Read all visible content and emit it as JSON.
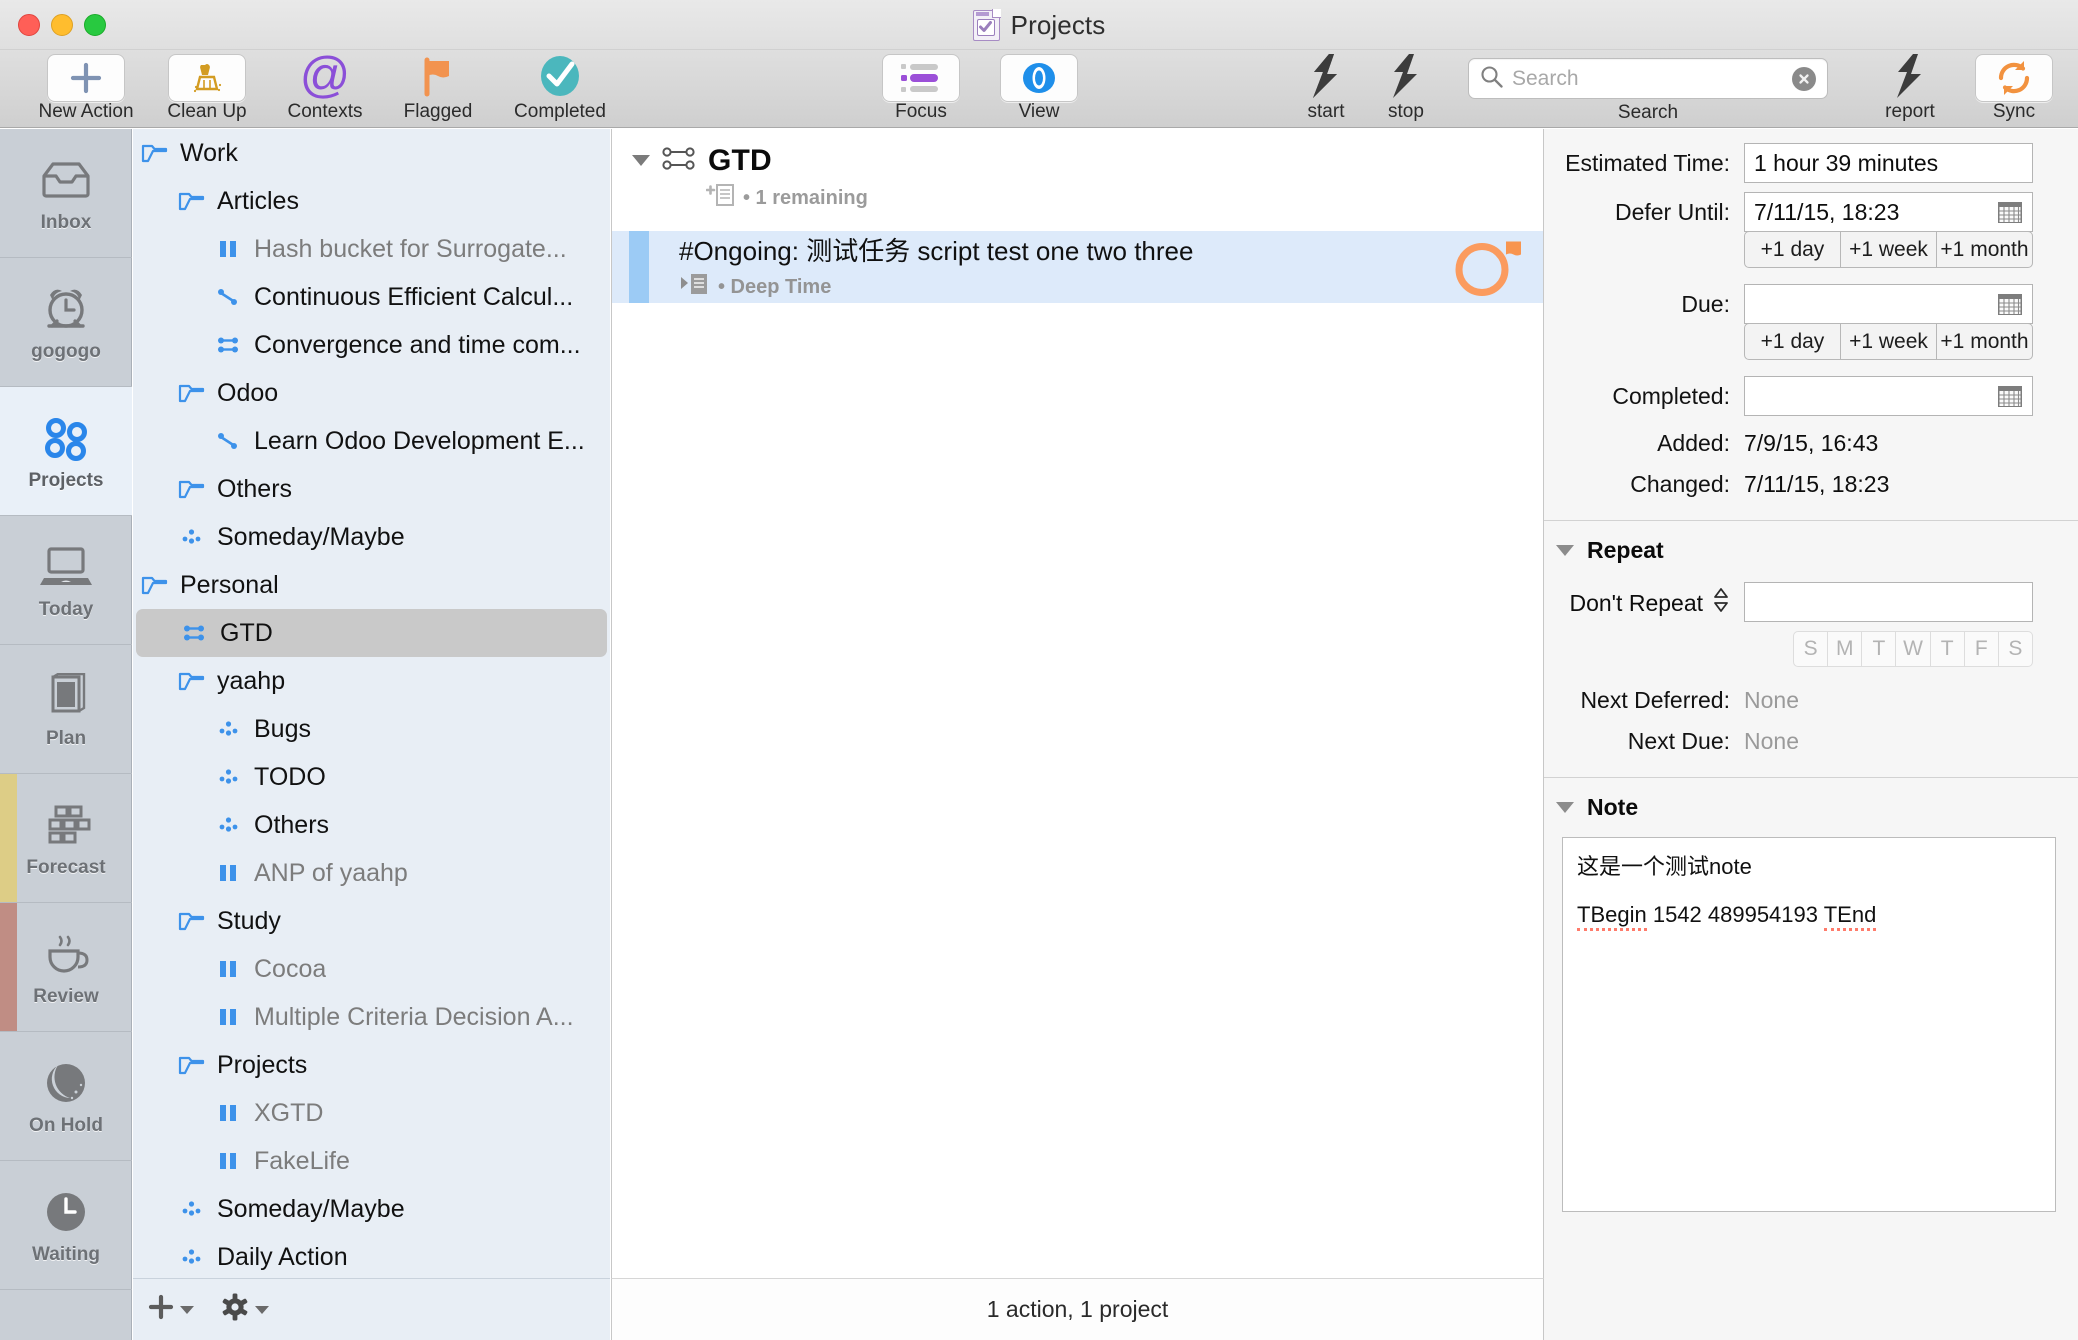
{
  "window": {
    "title": "Projects",
    "title_icon": "project-document-icon"
  },
  "toolbar": {
    "items": [
      {
        "label": "New Action",
        "icon": "plus-icon",
        "style": "well"
      },
      {
        "label": "Clean Up",
        "icon": "broom-icon",
        "style": "well"
      },
      {
        "label": "Contexts",
        "icon": "at-sign-icon",
        "style": "plain"
      },
      {
        "label": "Flagged",
        "icon": "flag-icon",
        "style": "plain"
      },
      {
        "label": "Completed",
        "icon": "check-circle-icon",
        "style": "plain"
      },
      {
        "label": "Focus",
        "icon": "focus-list-icon",
        "style": "well"
      },
      {
        "label": "View",
        "icon": "eye-icon",
        "style": "well"
      },
      {
        "label": "start",
        "icon": "script-bolt-icon",
        "style": "plain"
      },
      {
        "label": "stop",
        "icon": "script-bolt-icon",
        "style": "plain"
      },
      {
        "label": "report",
        "icon": "script-bolt-icon",
        "style": "plain"
      },
      {
        "label": "Sync",
        "icon": "sync-refresh-icon",
        "style": "well"
      }
    ],
    "search": {
      "label": "Search",
      "placeholder": "Search",
      "value": "",
      "search_icon": "magnifier-icon",
      "clear_icon": "clear-x-icon"
    }
  },
  "rail": {
    "items": [
      {
        "label": "Inbox",
        "icon": "inbox-tray-icon",
        "selected": false,
        "strip": ""
      },
      {
        "label": "gogogo",
        "icon": "alarm-clock-icon",
        "selected": false,
        "strip": ""
      },
      {
        "label": "Projects",
        "icon": "projects-dots-icon",
        "selected": true,
        "strip": ""
      },
      {
        "label": "Today",
        "icon": "laptop-icon",
        "selected": false,
        "strip": ""
      },
      {
        "label": "Plan",
        "icon": "book-icon",
        "selected": false,
        "strip": ""
      },
      {
        "label": "Forecast",
        "icon": "forecast-grid-icon",
        "selected": false,
        "strip": "#ddcd86"
      },
      {
        "label": "Review",
        "icon": "coffee-cup-icon",
        "selected": false,
        "strip": "#c08d84"
      },
      {
        "label": "On Hold",
        "icon": "moon-icon",
        "selected": false,
        "strip": ""
      },
      {
        "label": "Waiting",
        "icon": "clock-icon",
        "selected": false,
        "strip": ""
      }
    ]
  },
  "tree": {
    "rows": [
      {
        "label": "Work",
        "icon": "folder-icon",
        "indent": 0,
        "dim": false,
        "selected": false
      },
      {
        "label": "Articles",
        "icon": "folder-icon",
        "indent": 1,
        "dim": false,
        "selected": false
      },
      {
        "label": "Hash bucket for Surrogate...",
        "icon": "on-hold-project-icon",
        "indent": 2,
        "dim": true,
        "selected": false
      },
      {
        "label": "Continuous Efficient Calcul...",
        "icon": "sequential-project-icon",
        "indent": 2,
        "dim": false,
        "selected": false
      },
      {
        "label": "Convergence and time com...",
        "icon": "parallel-project-icon",
        "indent": 2,
        "dim": false,
        "selected": false
      },
      {
        "label": "Odoo",
        "icon": "folder-icon",
        "indent": 1,
        "dim": false,
        "selected": false
      },
      {
        "label": "Learn Odoo Development E...",
        "icon": "sequential-project-icon",
        "indent": 2,
        "dim": false,
        "selected": false
      },
      {
        "label": "Others",
        "icon": "folder-icon",
        "indent": 1,
        "dim": false,
        "selected": false
      },
      {
        "label": "Someday/Maybe",
        "icon": "single-actions-icon",
        "indent": 1,
        "dim": false,
        "selected": false
      },
      {
        "label": "Personal",
        "icon": "folder-icon",
        "indent": 0,
        "dim": false,
        "selected": false
      },
      {
        "label": "GTD",
        "icon": "parallel-project-icon",
        "indent": 1,
        "dim": false,
        "selected": true
      },
      {
        "label": "yaahp",
        "icon": "folder-icon",
        "indent": 1,
        "dim": false,
        "selected": false
      },
      {
        "label": "Bugs",
        "icon": "single-actions-icon",
        "indent": 2,
        "dim": false,
        "selected": false
      },
      {
        "label": "TODO",
        "icon": "single-actions-icon",
        "indent": 2,
        "dim": false,
        "selected": false
      },
      {
        "label": "Others",
        "icon": "single-actions-icon",
        "indent": 2,
        "dim": false,
        "selected": false
      },
      {
        "label": "ANP of yaahp",
        "icon": "on-hold-project-icon",
        "indent": 2,
        "dim": true,
        "selected": false
      },
      {
        "label": "Study",
        "icon": "folder-icon",
        "indent": 1,
        "dim": false,
        "selected": false
      },
      {
        "label": "Cocoa",
        "icon": "on-hold-project-icon",
        "indent": 2,
        "dim": true,
        "selected": false
      },
      {
        "label": "Multiple Criteria Decision A...",
        "icon": "on-hold-project-icon",
        "indent": 2,
        "dim": true,
        "selected": false
      },
      {
        "label": "Projects",
        "icon": "folder-icon",
        "indent": 1,
        "dim": false,
        "selected": false
      },
      {
        "label": "XGTD",
        "icon": "on-hold-project-icon",
        "indent": 2,
        "dim": true,
        "selected": false
      },
      {
        "label": "FakeLife",
        "icon": "on-hold-project-icon",
        "indent": 2,
        "dim": true,
        "selected": false
      },
      {
        "label": "Someday/Maybe",
        "icon": "single-actions-icon",
        "indent": 1,
        "dim": false,
        "selected": false
      },
      {
        "label": "Daily Action",
        "icon": "single-actions-icon",
        "indent": 1,
        "dim": false,
        "selected": false
      }
    ],
    "footer": {
      "add_icon": "plus-icon",
      "add_chevron_icon": "chevron-down-icon",
      "gear_icon": "gear-icon",
      "gear_chevron_icon": "chevron-down-icon"
    }
  },
  "main": {
    "project": {
      "disclosure_icon": "disclosure-triangle-down-icon",
      "type_icon": "parallel-project-icon",
      "title": "GTD",
      "note_icon": "add-note-icon",
      "meta": "• 1 remaining"
    },
    "task": {
      "title": "#Ongoing: 测试任务 script test one two three",
      "note_icon": "note-disclosure-icon",
      "meta": "• Deep Time",
      "status_circle_icon": "incomplete-circle-icon",
      "flag_icon": "flag-icon",
      "flag_color": "#f8954f",
      "circle_color": "#fb9b5e",
      "row_bg": "#ddeafa"
    },
    "status_bar": "1 action, 1 project"
  },
  "inspector": {
    "estimated_time": {
      "label": "Estimated Time:",
      "value": "1 hour 39 minutes"
    },
    "defer_until": {
      "label": "Defer Until:",
      "value": "7/11/15, 18:23",
      "calendar_icon": "calendar-icon",
      "quick": [
        "+1 day",
        "+1 week",
        "+1 month"
      ]
    },
    "due": {
      "label": "Due:",
      "value": "",
      "calendar_icon": "calendar-icon",
      "quick": [
        "+1 day",
        "+1 week",
        "+1 month"
      ]
    },
    "completed": {
      "label": "Completed:",
      "value": "",
      "calendar_icon": "calendar-icon"
    },
    "added": {
      "label": "Added:",
      "value": "7/9/15, 16:43"
    },
    "changed": {
      "label": "Changed:",
      "value": "7/11/15, 18:23"
    },
    "repeat": {
      "section_title": "Repeat",
      "disclosure_icon": "disclosure-triangle-down-icon",
      "mode": "Don't Repeat",
      "stepper_icon": "updown-stepper-icon",
      "value": "",
      "days": [
        "S",
        "M",
        "T",
        "W",
        "T",
        "F",
        "S"
      ],
      "next_deferred": {
        "label": "Next Deferred:",
        "value": "None"
      },
      "next_due": {
        "label": "Next Due:",
        "value": "None"
      }
    },
    "note": {
      "section_title": "Note",
      "disclosure_icon": "disclosure-triangle-down-icon",
      "line1": "这是一个测试note",
      "line2_a": "TBegin",
      "line2_b": " 1542 489954193 ",
      "line2_c": "TEnd"
    }
  }
}
